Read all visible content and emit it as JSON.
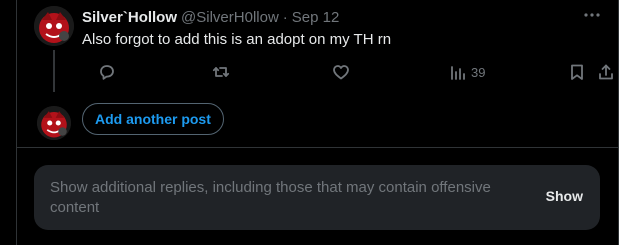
{
  "tweet": {
    "author_name": "Silver`Hollow",
    "author_handle": "@SilverH0llow",
    "separator": "·",
    "date": "Sep 12",
    "text": "Also forgot to add this is an adopt on my TH rn",
    "views_count": "39",
    "more_icon": "more-horizontal-icon"
  },
  "actions": {
    "reply_icon": "reply-icon",
    "repost_icon": "repost-icon",
    "like_icon": "like-icon",
    "views_icon": "views-icon",
    "bookmark_icon": "bookmark-icon",
    "share_icon": "share-icon"
  },
  "composer": {
    "add_post_label": "Add another post"
  },
  "hidden_replies": {
    "message": "Show additional replies, including those that may contain offensive content",
    "show_label": "Show"
  },
  "colors": {
    "background": "#000000",
    "accent": "#1d9bf0",
    "muted": "#71767b",
    "text": "#e7e9ea",
    "panel": "#202327"
  }
}
